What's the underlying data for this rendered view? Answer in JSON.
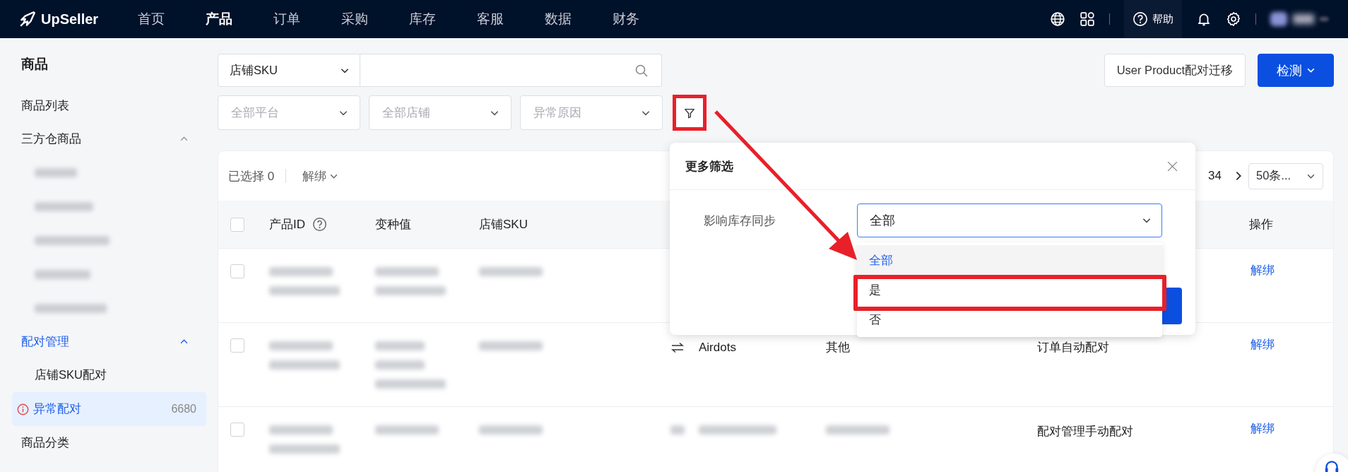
{
  "header": {
    "logo": "UpSeller",
    "nav": [
      {
        "label": "首页",
        "selected": false
      },
      {
        "label": "产品",
        "selected": true
      },
      {
        "label": "订单",
        "selected": false
      },
      {
        "label": "采购",
        "selected": false
      },
      {
        "label": "库存",
        "selected": false
      },
      {
        "label": "客服",
        "selected": false
      },
      {
        "label": "数据",
        "selected": false
      },
      {
        "label": "财务",
        "selected": false
      }
    ],
    "help": "帮助"
  },
  "sidebar": {
    "title": "商品",
    "items": [
      {
        "kind": "item",
        "label": "商品列表",
        "selected": false
      },
      {
        "kind": "group",
        "label": "三方仓商品",
        "expanded": true,
        "active": false,
        "children": [
          {
            "kind": "blurred"
          },
          {
            "kind": "blurred"
          },
          {
            "kind": "blurred"
          },
          {
            "kind": "blurred"
          },
          {
            "kind": "blurred"
          }
        ]
      },
      {
        "kind": "group",
        "label": "配对管理",
        "expanded": true,
        "active": true,
        "children": [
          {
            "kind": "item",
            "label": "店铺SKU配对",
            "selected": false
          },
          {
            "kind": "item",
            "label": "异常配对",
            "selected": true,
            "alert": true,
            "badge": "6680"
          }
        ]
      },
      {
        "kind": "item",
        "label": "商品分类",
        "selected": false
      }
    ]
  },
  "search": {
    "type_select": "店铺SKU"
  },
  "filters": [
    {
      "placeholder": "全部平台"
    },
    {
      "placeholder": "全部店铺"
    },
    {
      "placeholder": "异常原因"
    }
  ],
  "actions": {
    "migrate": "User Product配对迁移",
    "detect": "检测"
  },
  "toolbar": {
    "selected_count": "已选择 0",
    "unbind": "解绑",
    "page": "34",
    "page_size": "50条..."
  },
  "table": {
    "all_selected": false,
    "columns": [
      {
        "kind": "label",
        "label": "产品ID",
        "help": true
      },
      {
        "kind": "label",
        "label": "变种值"
      },
      {
        "kind": "label",
        "label": "店铺SKU"
      },
      {
        "kind": "covered"
      },
      {
        "kind": "covered"
      },
      {
        "kind": "covered"
      },
      {
        "kind": "label",
        "label": "操作"
      }
    ],
    "rows": [
      {
        "selected": false,
        "cells": [
          {
            "kind": "blurred-two"
          },
          {
            "kind": "blurred-two"
          },
          {
            "kind": "blurred-one"
          },
          {
            "kind": "empty"
          },
          {
            "kind": "empty"
          },
          {
            "kind": "empty"
          },
          {
            "kind": "link",
            "text": "解绑"
          }
        ]
      },
      {
        "selected": false,
        "cells": [
          {
            "kind": "blurred-two"
          },
          {
            "kind": "blurred-three"
          },
          {
            "kind": "blurred-one"
          },
          {
            "kind": "swap-text",
            "text": "Airdots"
          },
          {
            "kind": "text",
            "text": "其他"
          },
          {
            "kind": "text",
            "text": "订单自动配对"
          },
          {
            "kind": "link",
            "text": "解绑"
          }
        ]
      },
      {
        "selected": false,
        "cells": [
          {
            "kind": "blurred-two"
          },
          {
            "kind": "blurred-one"
          },
          {
            "kind": "blurred-one"
          },
          {
            "kind": "swap-blurred"
          },
          {
            "kind": "blurred-one"
          },
          {
            "kind": "text",
            "text": "配对管理手动配对"
          },
          {
            "kind": "link",
            "text": "解绑"
          }
        ]
      }
    ]
  },
  "popup": {
    "title": "更多筛选",
    "field_label": "影响库存同步",
    "value": "全部",
    "options": [
      {
        "label": "全部",
        "selected": true
      },
      {
        "label": "是",
        "selected": false
      },
      {
        "label": "否",
        "selected": false
      }
    ]
  }
}
